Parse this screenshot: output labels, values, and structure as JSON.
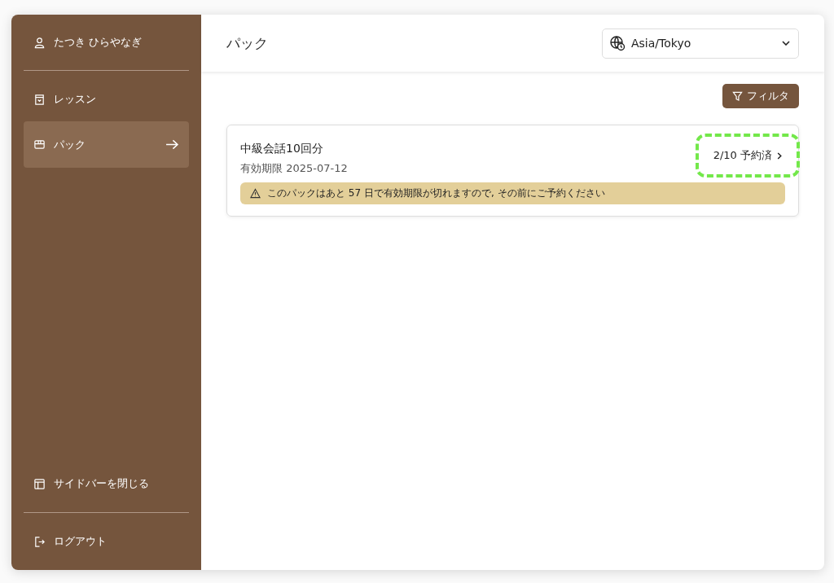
{
  "sidebar": {
    "user": "たつき ひらやなぎ",
    "items": [
      {
        "kind": "lessons",
        "label": "レッスン",
        "selected": false
      },
      {
        "kind": "packs",
        "label": "パック",
        "selected": true
      }
    ],
    "collapse": "サイドバーを閉じる",
    "logout": "ログアウト"
  },
  "header": {
    "title": "パック",
    "timezone": "Asia/Tokyo"
  },
  "filter_button": "フィルタ",
  "packs": [
    {
      "name": "中級会話10回分",
      "expiry": "有効期限 2025-07-12",
      "booked": "2/10 予約済",
      "highlighted": true,
      "warning": "このパックはあと 57 日で有効期限が切れますので, その前にご予約ください"
    }
  ]
}
